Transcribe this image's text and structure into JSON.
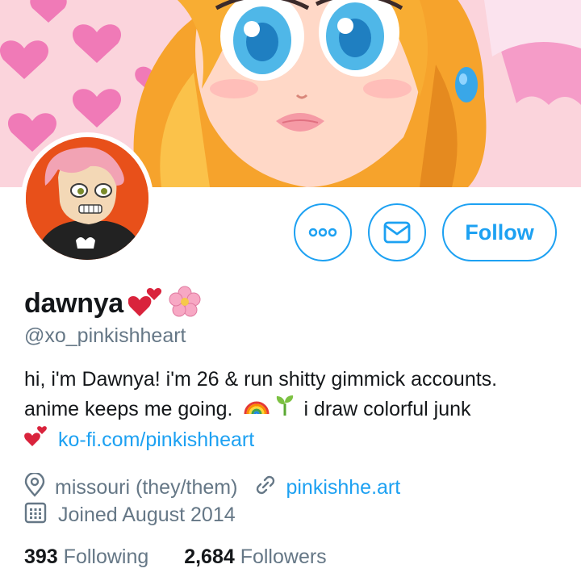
{
  "profile": {
    "display_name": "dawnya",
    "handle": "@xo_pinkishheart",
    "name_icons": [
      "two-hearts-icon",
      "cherry-blossom-icon"
    ]
  },
  "actions": {
    "more_icon": "more-dots-icon",
    "message_icon": "envelope-icon",
    "follow_label": "Follow"
  },
  "bio": {
    "line1": "hi, i'm Dawnya! i'm 26 & run shitty gimmick accounts.",
    "line2_text": "anime keeps me going.",
    "line2_icons": [
      "rainbow-icon",
      "seedling-icon"
    ],
    "line2_tail": "i draw colorful junk",
    "line3_icon": "two-hearts-icon",
    "link": "ko-fi.com/pinkishheart"
  },
  "meta": {
    "location": "missouri (they/them)",
    "website": "pinkishhe.art",
    "joined": "Joined August 2014"
  },
  "stats": {
    "following_count": "393",
    "following_label": "Following",
    "followers_count": "2,684",
    "followers_label": "Followers"
  },
  "colors": {
    "accent": "#1da1f2",
    "secondary_text": "#657786",
    "primary_text": "#14171a"
  }
}
